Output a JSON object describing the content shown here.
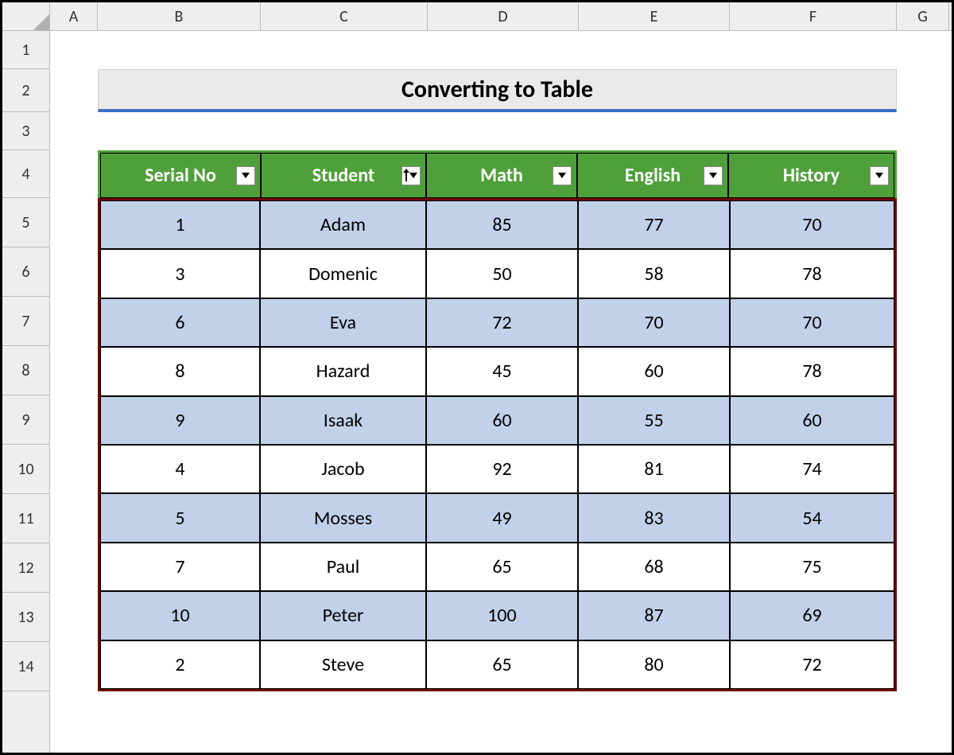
{
  "columns": [
    "A",
    "B",
    "C",
    "D",
    "E",
    "F",
    "G"
  ],
  "rowLabels": [
    "1",
    "2",
    "3",
    "4",
    "5",
    "6",
    "7",
    "8",
    "9",
    "10",
    "11",
    "12",
    "13",
    "14"
  ],
  "title": "Converting to Table",
  "headers": {
    "serial": "Serial No",
    "student": "Student",
    "math": "Math",
    "english": "English",
    "history": "History"
  },
  "sortedHeader": "student",
  "rows": [
    {
      "serial": "1",
      "student": "Adam",
      "math": "85",
      "english": "77",
      "history": "70"
    },
    {
      "serial": "3",
      "student": "Domenic",
      "math": "50",
      "english": "58",
      "history": "78"
    },
    {
      "serial": "6",
      "student": "Eva",
      "math": "72",
      "english": "70",
      "history": "70"
    },
    {
      "serial": "8",
      "student": "Hazard",
      "math": "45",
      "english": "60",
      "history": "78"
    },
    {
      "serial": "9",
      "student": "Isaak",
      "math": "60",
      "english": "55",
      "history": "60"
    },
    {
      "serial": "4",
      "student": "Jacob",
      "math": "92",
      "english": "81",
      "history": "74"
    },
    {
      "serial": "5",
      "student": "Mosses",
      "math": "49",
      "english": "83",
      "history": "54"
    },
    {
      "serial": "7",
      "student": "Paul",
      "math": "65",
      "english": "68",
      "history": "75"
    },
    {
      "serial": "10",
      "student": "Peter",
      "math": "100",
      "english": "87",
      "history": "69"
    },
    {
      "serial": "2",
      "student": "Steve",
      "math": "65",
      "english": "80",
      "history": "72"
    }
  ]
}
